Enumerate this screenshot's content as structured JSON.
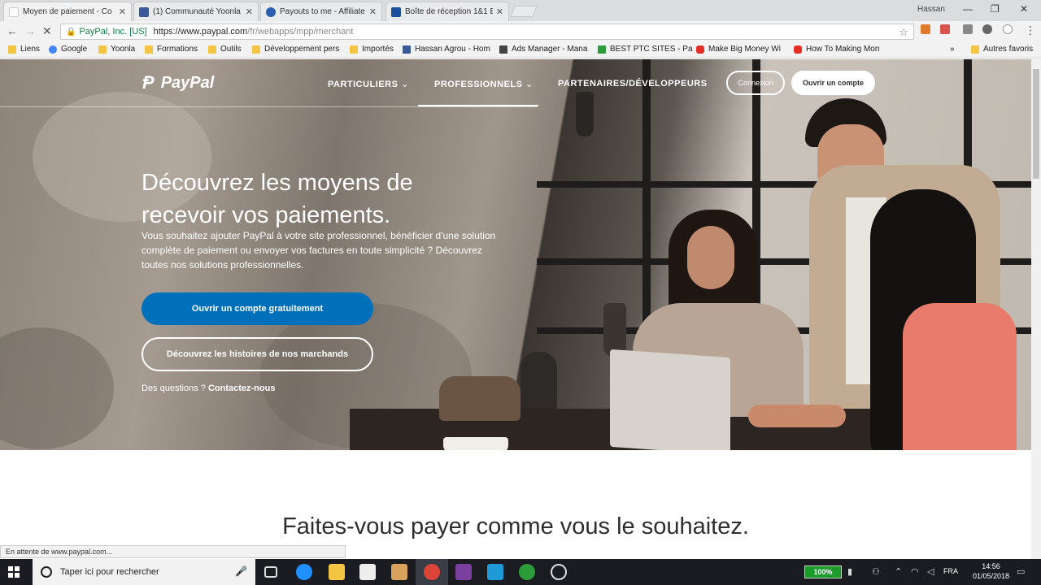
{
  "browser": {
    "tabs": [
      {
        "title": "Moyen de paiement - Co",
        "favicon_color": "#ffffff",
        "active": true
      },
      {
        "title": "(1) Communauté Yoonla",
        "favicon_color": "#3b5998",
        "active": false
      },
      {
        "title": "Payouts to me - Affiliate",
        "favicon_color": "#2b5fb0",
        "active": false
      },
      {
        "title": "Boîte de réception 1&1 E",
        "favicon_color": "#1a4f9c",
        "active": false
      }
    ],
    "window_user": "Hassan",
    "address": {
      "ev_label": "PayPal, Inc. [US]",
      "url_main": "https://www.paypal.com",
      "url_path": "/fr/webapps/mpp/merchant"
    },
    "bookmarks": [
      {
        "label": "Liens",
        "icon": "folder-icon"
      },
      {
        "label": "Google",
        "icon": "google-icon"
      },
      {
        "label": "Yoonla",
        "icon": "folder-icon"
      },
      {
        "label": "Formations",
        "icon": "folder-icon"
      },
      {
        "label": "Outils",
        "icon": "folder-icon"
      },
      {
        "label": "Développement pers",
        "icon": "folder-icon"
      },
      {
        "label": "Importés",
        "icon": "folder-icon"
      },
      {
        "label": "Hassan Agrou - Hom",
        "icon": "facebook-icon"
      },
      {
        "label": "Ads Manager - Mana",
        "icon": "ads-icon"
      },
      {
        "label": "BEST PTC SITES - Pa",
        "icon": "ptc-icon"
      },
      {
        "label": "Make Big Money Wi",
        "icon": "youtube-icon"
      },
      {
        "label": "How To Making Mon",
        "icon": "youtube-icon"
      }
    ],
    "bookmarks_more": "»",
    "other_bookmarks": "Autres favoris",
    "status_text": "En attente de www.paypal.com..."
  },
  "page": {
    "logo": "PayPal",
    "nav": {
      "particuliers": "PARTICULIERS",
      "professionnels": "PROFESSIONNELS",
      "partenaires": "PARTENAIRES/DÉVELOPPEURS"
    },
    "connexion": "Connexion",
    "ouvrir_compte": "Ouvrir un compte",
    "headline": "Découvrez les moyens de recevoir vos paiements.",
    "lead": "Vous souhaitez ajouter PayPal à votre site professionnel, bénéficier d'une solution complète de paiement ou envoyer vos factures en toute simplicité ? Découvrez toutes nos solutions professionnelles.",
    "cta_primary": "Ouvrir un compte gratuitement",
    "cta_secondary": "Découvrez les histoires de nos marchands",
    "question_prefix": "Des questions ?",
    "question_link": "Contactez-nous",
    "section_title": "Faites-vous payer comme vous le souhaitez."
  },
  "taskbar": {
    "search_placeholder": "Taper ici pour rechercher",
    "battery": "100%",
    "lang": "FRA",
    "time": "14:56",
    "date": "01/05/2018"
  },
  "colors": {
    "paypal_blue": "#0070ba",
    "battery_green": "#1a9b2a"
  }
}
